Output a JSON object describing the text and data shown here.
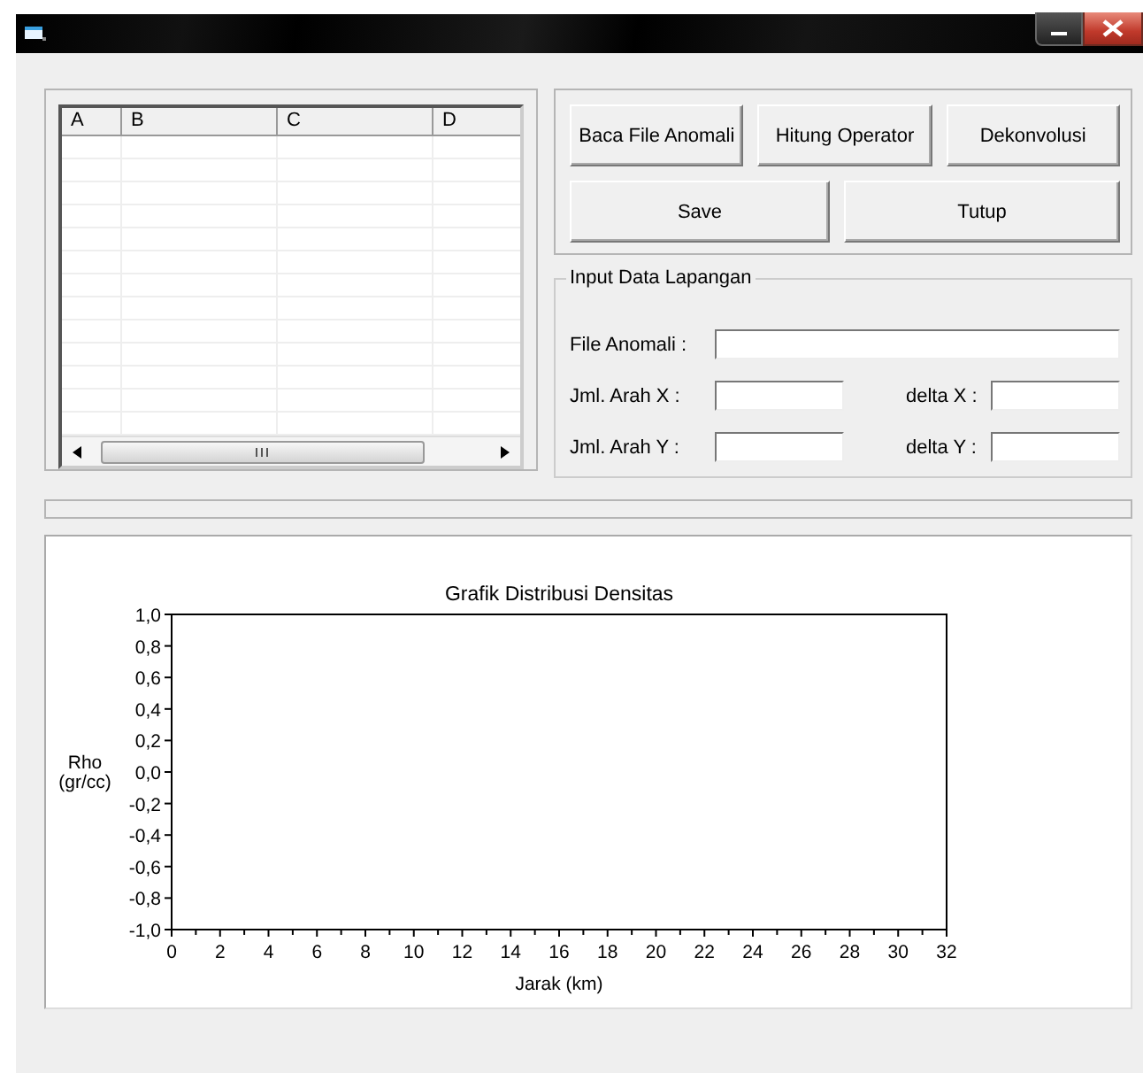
{
  "grid": {
    "columns": [
      "A",
      "B",
      "C",
      "D"
    ]
  },
  "buttons": [
    {
      "label": "Baca File Anomali",
      "kind": "small"
    },
    {
      "label": "Hitung Operator",
      "kind": "small"
    },
    {
      "label": "Dekonvolusi",
      "kind": "small"
    },
    {
      "label": "Save",
      "kind": "wide"
    },
    {
      "label": "Tutup",
      "kind": "wide"
    }
  ],
  "input_group": {
    "title": "Input Data Lapangan",
    "fields": [
      {
        "label": "File Anomali :",
        "kind": "long"
      },
      {
        "label": "Jml. Arah X :",
        "kind": "short"
      },
      {
        "label": "delta X :",
        "kind": "short"
      },
      {
        "label": "Jml. Arah Y :",
        "kind": "short"
      },
      {
        "label": "delta Y :",
        "kind": "short"
      }
    ]
  },
  "progress": {
    "level": 0
  },
  "chart": {
    "chart_data": {
      "type": "line",
      "title": "Grafik Distribusi Densitas",
      "xlabel": "Jarak (km)",
      "ylabel": "Rho (gr/cc)",
      "xlim": [
        0,
        32
      ],
      "ylim": [
        -1,
        1
      ],
      "xticks": [
        0,
        2,
        4,
        6,
        8,
        10,
        12,
        14,
        16,
        18,
        20,
        22,
        24,
        26,
        28,
        30,
        32
      ],
      "yticks": [
        {
          "value": 1,
          "label": "1,0"
        },
        {
          "value": 0.8,
          "label": "0,8"
        },
        {
          "value": 0.6,
          "label": "0,6"
        },
        {
          "value": 0.4,
          "label": "0,4"
        },
        {
          "value": 0.2,
          "label": "0,2"
        },
        {
          "value": 0,
          "label": "0,0"
        },
        {
          "value": -0.2,
          "label": "-0,2"
        },
        {
          "value": -0.4,
          "label": "-0,4"
        },
        {
          "value": -0.6,
          "label": "-0,6"
        },
        {
          "value": -0.8,
          "label": "-0,8"
        },
        {
          "value": -1,
          "label": "-1,0"
        }
      ]
    }
  }
}
